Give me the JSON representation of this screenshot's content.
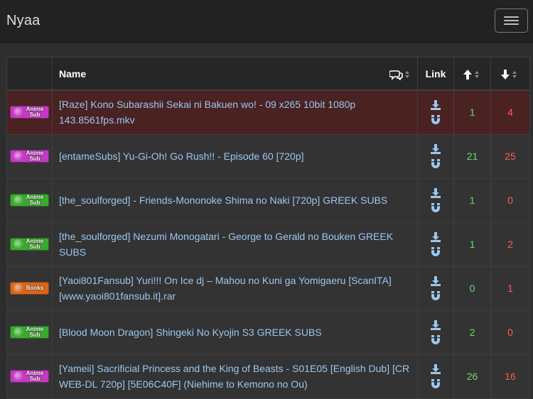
{
  "navbar": {
    "brand": "Nyaa"
  },
  "table": {
    "headers": {
      "category": "",
      "name": "Name",
      "comments_icon": "comments-icon",
      "link": "Link",
      "seeders_icon": "arrow-up-icon",
      "leechers_icon": "arrow-down-icon"
    },
    "rows": [
      {
        "status": "danger",
        "category": "Anime Sub",
        "category_lines": [
          "Anime",
          "Sub"
        ],
        "category_color": "#c23ac0",
        "name": "[Raze] Kono Subarashii Sekai ni Bakuen wo! - 09 x265 10bit 1080p 143.8561fps.mkv",
        "seeders": "1",
        "leechers": "4"
      },
      {
        "status": "default",
        "category": "Anime Sub",
        "category_lines": [
          "Anime",
          "Sub"
        ],
        "category_color": "#c23ac0",
        "name": "[entameSubs] Yu-Gi-Oh! Go Rush!! - Episode 60 [720p]",
        "seeders": "21",
        "leechers": "25"
      },
      {
        "status": "default",
        "category": "Anime Sub",
        "category_lines": [
          "Anime",
          "Sub"
        ],
        "category_color": "#3aa92e",
        "name": "[the_soulforged] - Friends-Mononoke Shima no Naki [720p] GREEK SUBS",
        "seeders": "1",
        "leechers": "0"
      },
      {
        "status": "default",
        "category": "Anime Sub",
        "category_lines": [
          "Anime",
          "Sub"
        ],
        "category_color": "#3aa92e",
        "name": "[the_soulforged] Nezumi Monogatari - George to Gerald no Bouken GREEK SUBS",
        "seeders": "1",
        "leechers": "2"
      },
      {
        "status": "default",
        "category": "Books",
        "category_lines": [
          "Books"
        ],
        "category_color": "#d9661c",
        "name": "[Yaoi801Fansub] Yuri!!! On Ice dj – Mahou no Kuni ga Yomigaeru [ScanITA][www.yaoi801fansub.it].rar",
        "seeders": "0",
        "leechers": "1"
      },
      {
        "status": "default",
        "category": "Anime Sub",
        "category_lines": [
          "Anime",
          "Sub"
        ],
        "category_color": "#3aa92e",
        "name": "[Blood Moon Dragon] Shingeki No Kyojin S3 GREEK SUBS",
        "seeders": "2",
        "leechers": "0"
      },
      {
        "status": "default",
        "category": "Anime Sub",
        "category_lines": [
          "Anime",
          "Sub"
        ],
        "category_color": "#c23ac0",
        "name": "[Yameii] Sacrificial Princess and the King of Beasts - S01E05 [English Dub] [CR WEB-DL 720p] [5E06C40F] (Niehime to Kemono no Ou)",
        "seeders": "26",
        "leechers": "16"
      }
    ]
  },
  "colors": {
    "seeders": "#6fd66f",
    "leechers": "#ff5a5a",
    "link": "#9cc7ee",
    "danger_row": "#4a2222"
  }
}
